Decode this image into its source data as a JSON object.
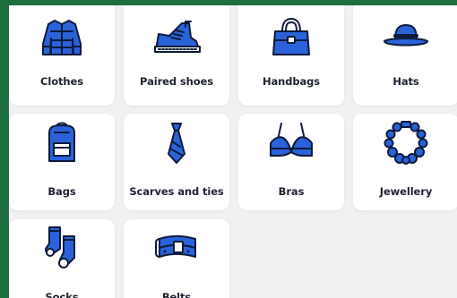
{
  "categories": [
    {
      "label": "Clothes",
      "icon": "jacket-icon"
    },
    {
      "label": "Paired shoes",
      "icon": "sneaker-icon"
    },
    {
      "label": "Handbags",
      "icon": "handbag-icon"
    },
    {
      "label": "Hats",
      "icon": "hat-icon"
    },
    {
      "label": "Bags",
      "icon": "backpack-icon"
    },
    {
      "label": "Scarves and ties",
      "icon": "tie-icon"
    },
    {
      "label": "Bras",
      "icon": "bra-icon"
    },
    {
      "label": "Jewellery",
      "icon": "necklace-icon"
    },
    {
      "label": "Socks",
      "icon": "socks-icon"
    },
    {
      "label": "Belts",
      "icon": "belt-icon"
    }
  ],
  "colors": {
    "accent": "#2a63d9",
    "outline": "#0d1a3a",
    "frame": "#1f6e3f"
  }
}
